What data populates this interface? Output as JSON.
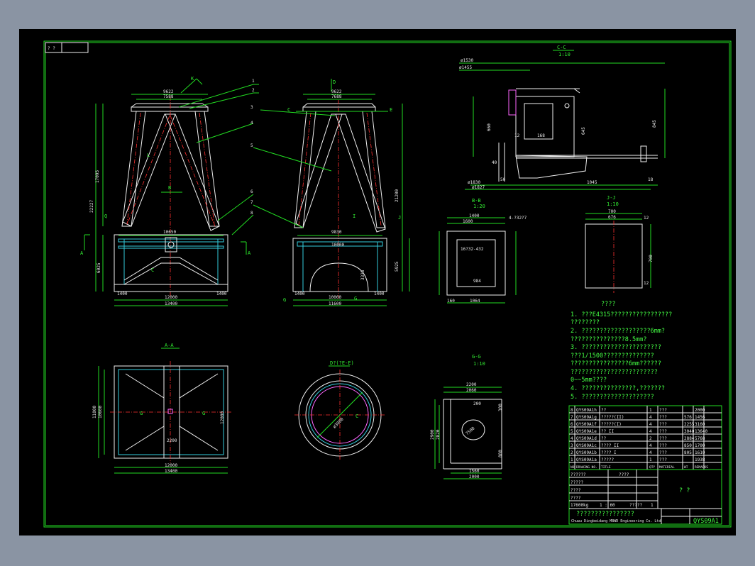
{
  "sheet": {
    "corner_tag": "? ?",
    "drawing_no": "QYS09A1",
    "company": "Chuwu Dingbeidang MBWD Engineering Co. Ltd",
    "company_title": "????????????????",
    "title_box": "? ?",
    "title_scale": "1 : 60"
  },
  "views": {
    "front": {
      "d_top1": "9622",
      "d_top2": "7588",
      "d_height1": "17095",
      "d_height2": "22227",
      "d_base": "6025",
      "d_span": "10650",
      "d_w1": "12000",
      "d_w2": "13400",
      "d_l": "1400",
      "d_r": "1400",
      "m_h": "Q",
      "m_k": "K",
      "m_l": "L",
      "m_a1": "A",
      "m_a2": "A",
      "m_b": "B",
      "m_c": "C"
    },
    "side": {
      "d_top1": "9622",
      "d_top2": "7688",
      "d_height": "21200",
      "d_base": "5925",
      "d_span": "9830",
      "d_mid": "10000",
      "d_w1": "10000",
      "d_w2": "11600",
      "d_l": "1400",
      "d_r": "1400",
      "d_h2": "3335",
      "m_d": "D",
      "m_j": "J",
      "m_cl": "C",
      "m_cr": "E",
      "m_gl": "G",
      "m_gr": "G",
      "m_i": "I"
    },
    "cc": {
      "title": "C-C",
      "scale": "1:10",
      "d1": "ø1530",
      "d2": "ø1455",
      "d3": "ø1827",
      "d4": "ø1830",
      "d5": "1045",
      "d6": "168",
      "d7": "645",
      "d8": "845",
      "d9": "660",
      "d10": "12",
      "d11": "18",
      "d12": "40",
      "d13": "50"
    },
    "bb": {
      "title": "B-B",
      "scale": "1:20",
      "d1": "1400",
      "d2": "1600",
      "d3": "4-?32?7",
      "d4": "16?32-432",
      "d5": "984",
      "d6": "1064",
      "d7": "160"
    },
    "jj": {
      "title": "J-J",
      "scale": "1:10",
      "d1": "700",
      "d2": "676",
      "d3": "12",
      "d4": "700",
      "d5": "12"
    },
    "aa": {
      "title": "A-A",
      "d1": "12000",
      "d2": "13400",
      "d3": "11000",
      "d4": "10600",
      "d5": "12000",
      "d6": "2200",
      "m_g1": "G",
      "m_g2": "G"
    },
    "dd": {
      "title": "D?(?E-E)",
      "d1": "ø3880",
      "m_c": "C"
    },
    "gg": {
      "title": "G-G",
      "scale": "1:10",
      "d1": "2200",
      "d2": "2060",
      "d3": "2900",
      "d4": "2820",
      "d5": "1560",
      "d6": "2000",
      "d7": "200",
      "d8": "880",
      "d9": "300",
      "d10": "?500"
    }
  },
  "leaders": [
    "1",
    "2",
    "3",
    "4",
    "5",
    "6",
    "7",
    "8"
  ],
  "notes": {
    "heading": "????",
    "lines": [
      "1. ???E4315?????????????????",
      "   ????????",
      "2. ???????????????????6mm?",
      "   ???????????????8.5mm?",
      "3. ??????????????????????",
      "   ???1/1500??????????????",
      "   ????????????????6mm??????",
      "   ????????????????????????",
      "   0~~5mm????",
      "4. ???????????????,???????",
      "5. ????????????????????"
    ]
  },
  "parts_table": {
    "rows": [
      [
        "8",
        "QYS09A1h",
        "??",
        "1",
        "???",
        "",
        "2000"
      ],
      [
        "7",
        "QYS09A1g",
        "?????(II)",
        "4",
        "???",
        "576",
        "1456"
      ],
      [
        "6",
        "QYS09A1f",
        "?????(I)",
        "4",
        "???",
        "2255",
        "3160"
      ],
      [
        "5",
        "QYS09A1e",
        "?? II",
        "4",
        "???",
        "3040",
        "13640"
      ],
      [
        "4",
        "QYS09A1d",
        "??",
        "2",
        "???",
        "2884",
        "5768"
      ],
      [
        "3",
        "QYS09A1c",
        "???? II",
        "4",
        "???",
        "850",
        "1700"
      ],
      [
        "2",
        "QYS09A1b",
        "???? I",
        "4",
        "???",
        "805",
        "1610"
      ],
      [
        "1",
        "QYS09A1a",
        "?????",
        "1",
        "???",
        "",
        "1938"
      ]
    ],
    "header": [
      "NO",
      "DRAWING NO.",
      "TITLE",
      "QTY",
      "MATERIAL",
      "WT",
      "REMARKS"
    ]
  },
  "title_block": {
    "rows": [
      "??????",
      "?????",
      "????",
      "????",
      "????"
    ],
    "weight_label": "17600kg",
    "scale_label": "1 : 60",
    "sign_label": "?????",
    "sheet_no": "1"
  }
}
